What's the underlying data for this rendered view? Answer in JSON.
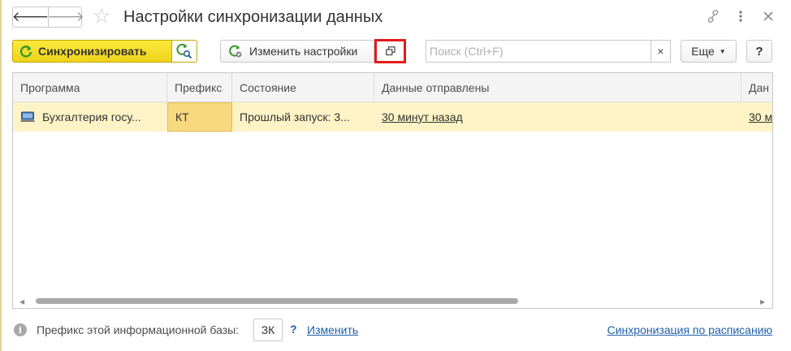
{
  "window": {
    "title": "Настройки синхронизации данных",
    "back_glyph": "🡐",
    "forward_glyph": "🡒",
    "star_glyph": "☆",
    "icons": [
      "link-icon",
      "more-vertical-icon",
      "close-icon"
    ]
  },
  "toolbar": {
    "sync_label": "Синхронизировать",
    "change_settings_label": "Изменить настройки",
    "search_placeholder": "Поиск (Ctrl+F)",
    "clear_glyph": "×",
    "more_label": "Еще",
    "help_label": "?"
  },
  "table": {
    "columns": [
      "Программа",
      "Префикс",
      "Состояние",
      "Данные отправлены",
      "Дан"
    ],
    "rows": [
      {
        "program": "Бухгалтерия госу...",
        "prefix": "КТ",
        "state": "Прошлый запуск: 3...",
        "sent": "30 минут назад",
        "received": "30 м"
      }
    ]
  },
  "footer": {
    "info_glyph": "i",
    "prefix_label": "Префикс этой информационной базы:",
    "prefix_value": "ЗК",
    "help_q": "?",
    "change_link": "Изменить",
    "schedule_link": "Синхронизация по расписанию"
  },
  "colors": {
    "accent_yellow": "#fbe93c",
    "selected_row": "#fdf3c6",
    "selected_cell": "#f8d97f",
    "highlight_red": "#e21b1b",
    "link_blue": "#1f5fa8",
    "icon_green": "#3a9a2a"
  }
}
